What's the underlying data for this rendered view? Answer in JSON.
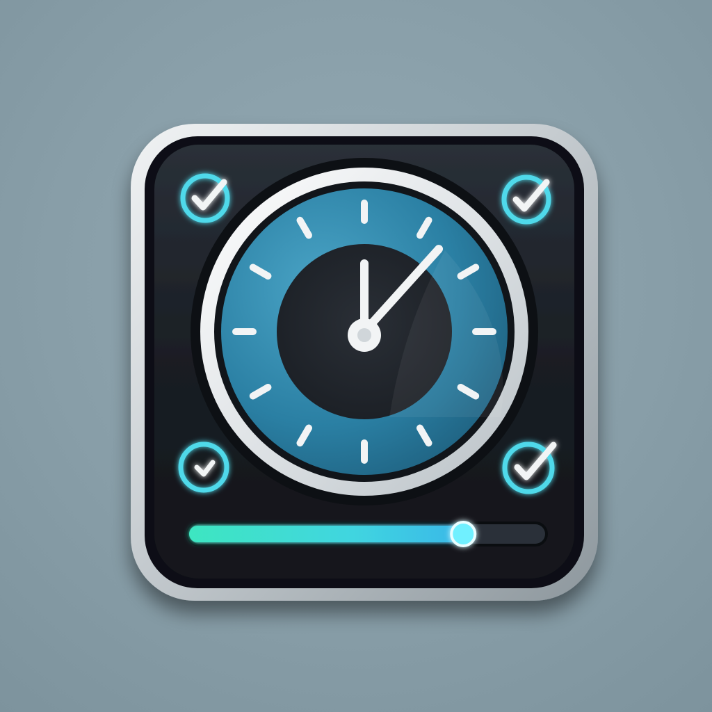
{
  "colors": {
    "background": "#8aa0aa",
    "frame_outer": "#d9dde0",
    "frame_inner": "#15191e",
    "accent_cyan": "#4fd9ea",
    "accent_teal": "#3ee0c0",
    "dial_blue": "#2e8fb4",
    "dial_dark": "#1d2229",
    "hands_white": "#f2f4f5"
  },
  "icons": {
    "corner_top_left": "check-circle-icon",
    "corner_top_right": "check-circle-icon",
    "corner_bottom_left": "check-circle-icon",
    "corner_bottom_right": "check-circle-icon",
    "center": "clock-icon"
  },
  "clock": {
    "hour_hand_angle_deg": 0,
    "minute_hand_angle_deg": 42,
    "tick_count": 12
  },
  "progress": {
    "value_fraction": 0.77
  }
}
